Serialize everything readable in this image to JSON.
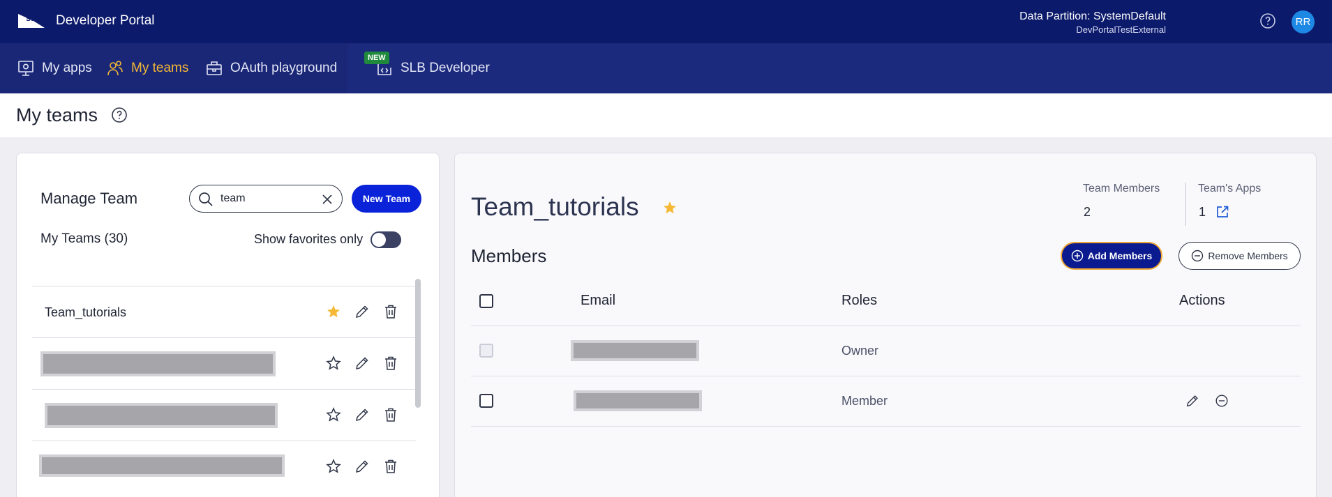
{
  "header": {
    "brand_title": "Developer Portal",
    "partition_label": "Data Partition: SystemDefault",
    "partition_sub": "DevPortalTestExternal",
    "avatar_initials": "RR",
    "icons": {
      "logo": "slb-logo-icon",
      "help": "help-circle-icon"
    }
  },
  "nav": {
    "items": [
      {
        "label": "My apps",
        "icon": "apps-monitor-icon",
        "active": false
      },
      {
        "label": "My teams",
        "icon": "users-icon",
        "active": true
      },
      {
        "label": "OAuth playground",
        "icon": "briefcase-icon",
        "active": false
      },
      {
        "label": "SLB Developer",
        "icon": "code-window-icon",
        "active": false
      }
    ],
    "new_badge": "NEW",
    "active_color": "#f5b935"
  },
  "page": {
    "title": "My teams"
  },
  "left_panel": {
    "title": "Manage Team",
    "search_value": "team",
    "new_team_label": "New Team",
    "my_teams_label": "My Teams (30)",
    "favorites_label": "Show favorites only",
    "favorites_toggle_on": false,
    "teams": [
      {
        "name": "Team_tutorials",
        "favorite": true,
        "redacted": false
      },
      {
        "name": "",
        "favorite": false,
        "redacted": true
      },
      {
        "name": "",
        "favorite": false,
        "redacted": true
      },
      {
        "name": "",
        "favorite": false,
        "redacted": true
      }
    ]
  },
  "right_panel": {
    "team_title": "Team_tutorials",
    "stats": {
      "members_label": "Team Members",
      "members_value": "2",
      "apps_label": "Team's Apps",
      "apps_value": "1"
    },
    "members_title": "Members",
    "add_members_label": "Add Members",
    "remove_members_label": "Remove Members",
    "table": {
      "headers": {
        "email": "Email",
        "roles": "Roles",
        "actions": "Actions"
      },
      "rows": [
        {
          "email_redacted": true,
          "role": "Owner",
          "selectable": false,
          "has_actions": false
        },
        {
          "email_redacted": true,
          "role": "Member",
          "selectable": true,
          "has_actions": true
        }
      ]
    }
  },
  "colors": {
    "header_bg": "#0c1a6b",
    "nav_bg": "#1c2a7e",
    "primary_button": "#0a23d8",
    "favorite_star": "#f5b935",
    "new_badge": "#1f8a3c"
  }
}
